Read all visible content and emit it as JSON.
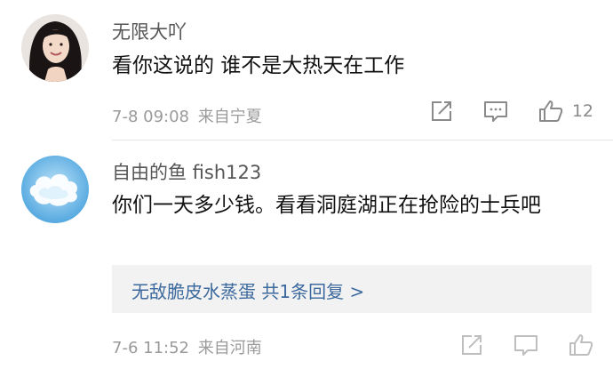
{
  "comments": [
    {
      "username": "无限大吖",
      "text": "看你这说的 谁不是大热天在工作",
      "date": "7-8 09:08",
      "location": "来自宁夏",
      "like_count": "12",
      "icons": [
        "share-icon",
        "comment-icon",
        "like-icon"
      ]
    },
    {
      "username": "自由的鱼 fish123",
      "text": "你们一天多少钱。看看洞庭湖正在抢险的士兵吧",
      "reply_preview": "无敌脆皮水蒸蛋  共1条回复 >",
      "date": "7-6 11:52",
      "location": "来自河南"
    }
  ],
  "colors": {
    "link": "#3d6a9e",
    "meta": "#9a9a9a",
    "reply_bg": "#f2f2f2"
  }
}
